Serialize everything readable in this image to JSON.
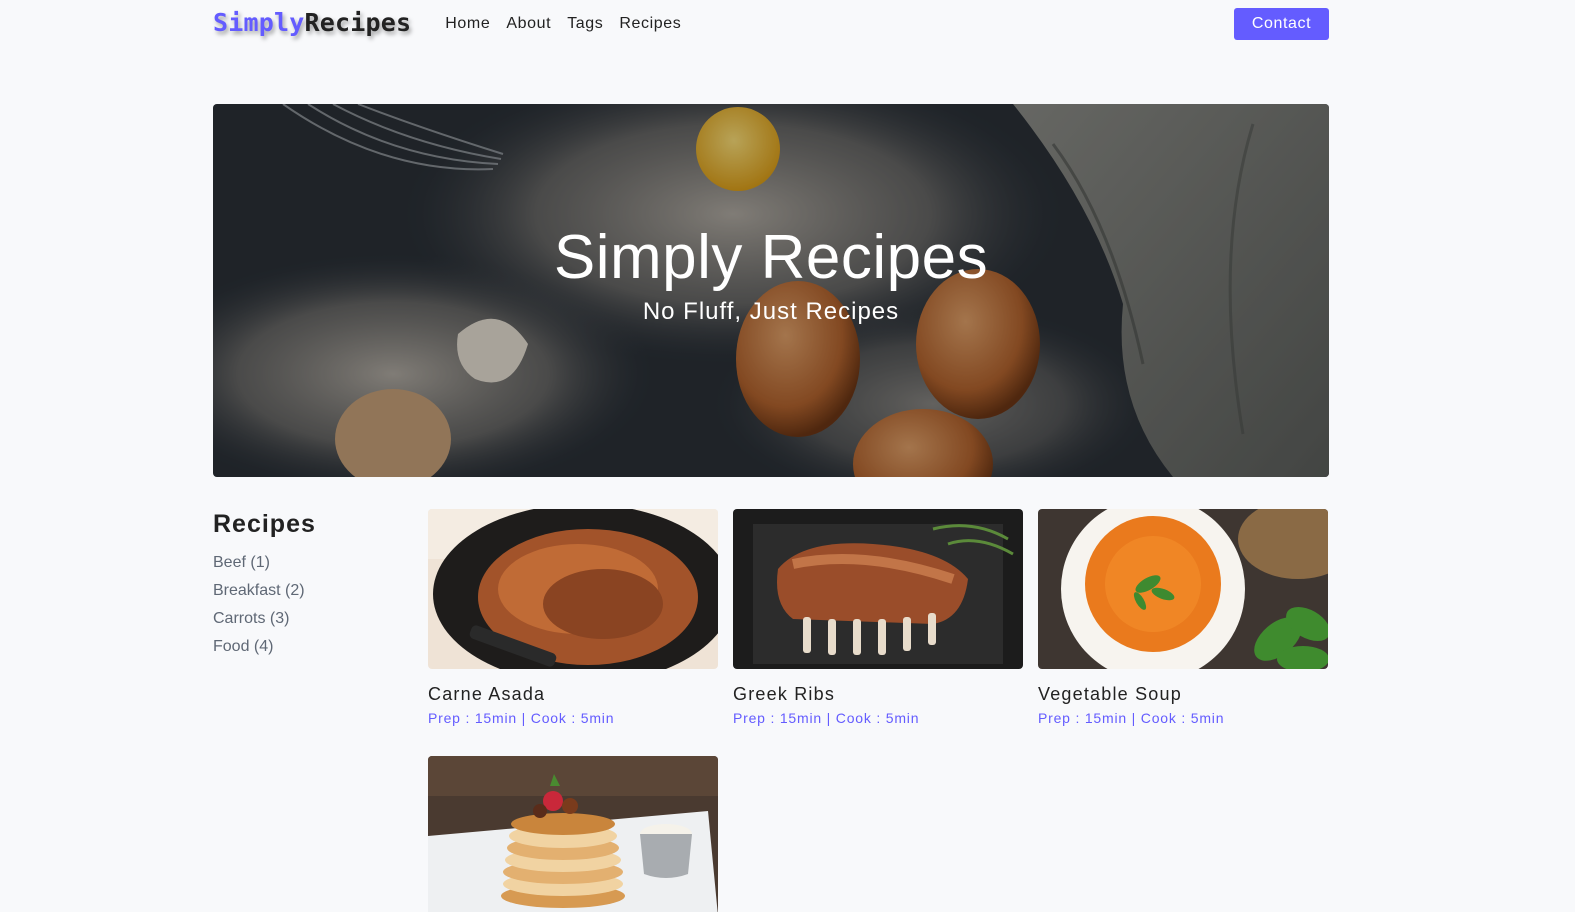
{
  "nav": {
    "logo_part1": "Simply",
    "logo_part2": "Recipes",
    "links": [
      "Home",
      "About",
      "Tags",
      "Recipes"
    ],
    "contact": "Contact"
  },
  "hero": {
    "title": "Simply Recipes",
    "subtitle": "No Fluff, Just Recipes"
  },
  "sidebar": {
    "title": "Recipes",
    "tags": [
      "Beef (1)",
      "Breakfast (2)",
      "Carrots (3)",
      "Food (4)"
    ]
  },
  "recipes": [
    {
      "title": "Carne Asada",
      "meta": "Prep : 15min | Cook : 5min"
    },
    {
      "title": "Greek Ribs",
      "meta": "Prep : 15min | Cook : 5min"
    },
    {
      "title": "Vegetable Soup",
      "meta": "Prep : 15min | Cook : 5min"
    },
    {
      "title": "",
      "meta": ""
    }
  ],
  "colors": {
    "accent": "#645cff",
    "background": "#f8f9fb",
    "tag_text": "#5f6875"
  }
}
